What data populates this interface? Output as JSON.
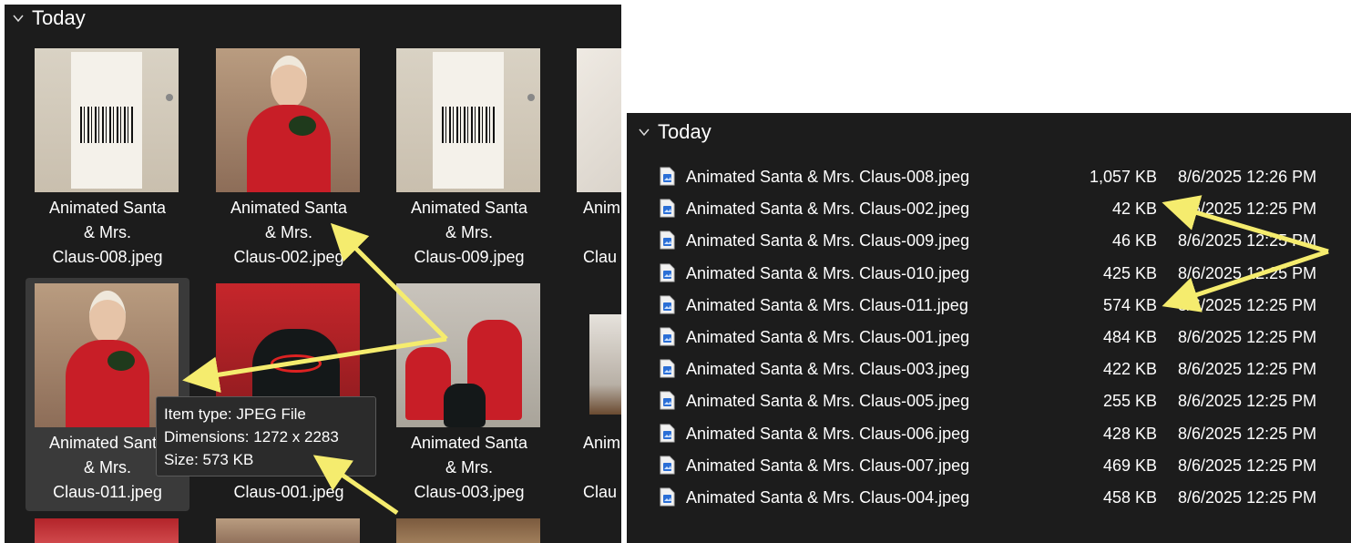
{
  "left_panel": {
    "group_header": "Today",
    "tiles": [
      {
        "label": "Animated Santa\n& Mrs.\nClaus-008.jpeg"
      },
      {
        "label": "Animated Santa\n& Mrs.\nClaus-002.jpeg"
      },
      {
        "label": "Animated Santa\n& Mrs.\nClaus-009.jpeg"
      },
      {
        "label": "Anim\n\nClau"
      },
      {
        "label": "Animated Santa\n& Mrs.\nClaus-011.jpeg"
      },
      {
        "label": "Animated Santa\n& Mrs.\nClaus-001.jpeg"
      },
      {
        "label": "Animated Santa\n& Mrs.\nClaus-003.jpeg"
      },
      {
        "label": "Anim\n\nClau"
      }
    ],
    "tooltip": {
      "item_type": "Item type: JPEG File",
      "dimensions": "Dimensions: 1272 x 2283",
      "size": "Size: 573 KB"
    }
  },
  "right_panel": {
    "group_header": "Today",
    "files": [
      {
        "name": "Animated Santa & Mrs. Claus-008.jpeg",
        "size": "1,057 KB",
        "date": "8/6/2025 12:26 PM"
      },
      {
        "name": "Animated Santa & Mrs. Claus-002.jpeg",
        "size": "42 KB",
        "date": "8/6/2025 12:25 PM"
      },
      {
        "name": "Animated Santa & Mrs. Claus-009.jpeg",
        "size": "46 KB",
        "date": "8/6/2025 12:25 PM"
      },
      {
        "name": "Animated Santa & Mrs. Claus-010.jpeg",
        "size": "425 KB",
        "date": "8/6/2025 12:25 PM"
      },
      {
        "name": "Animated Santa & Mrs. Claus-011.jpeg",
        "size": "574 KB",
        "date": "8/6/2025 12:25 PM"
      },
      {
        "name": "Animated Santa & Mrs. Claus-001.jpeg",
        "size": "484 KB",
        "date": "8/6/2025 12:25 PM"
      },
      {
        "name": "Animated Santa & Mrs. Claus-003.jpeg",
        "size": "422 KB",
        "date": "8/6/2025 12:25 PM"
      },
      {
        "name": "Animated Santa & Mrs. Claus-005.jpeg",
        "size": "255 KB",
        "date": "8/6/2025 12:25 PM"
      },
      {
        "name": "Animated Santa & Mrs. Claus-006.jpeg",
        "size": "428 KB",
        "date": "8/6/2025 12:25 PM"
      },
      {
        "name": "Animated Santa & Mrs. Claus-007.jpeg",
        "size": "469 KB",
        "date": "8/6/2025 12:25 PM"
      },
      {
        "name": "Animated Santa & Mrs. Claus-004.jpeg",
        "size": "458 KB",
        "date": "8/6/2025 12:25 PM"
      }
    ]
  },
  "colors": {
    "pane_background": "#1c1c1c",
    "selected_tile": "#3a3a3a",
    "annotation_arrow": "#f5ec6e",
    "file_icon_blue": "#2b6fd6"
  },
  "icons": {
    "group_toggle": "chevron-down-icon",
    "file": "jpeg-file-icon"
  }
}
